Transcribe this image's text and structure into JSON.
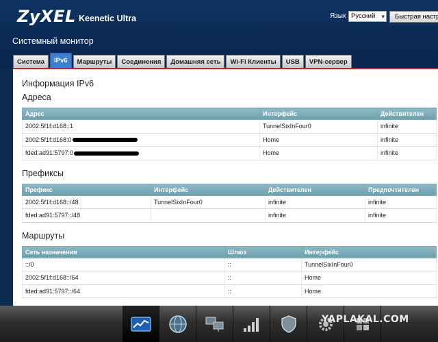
{
  "header": {
    "logo": "ZyXEL",
    "model": "Keenetic Ultra",
    "language_label": "Язык",
    "language_value": "Русский",
    "quick_setup_label": "Быстрая настр"
  },
  "page_title": "Системный монитор",
  "tabs": [
    {
      "label": "Система",
      "active": false
    },
    {
      "label": "IPv6",
      "active": true
    },
    {
      "label": "Маршруты",
      "active": false
    },
    {
      "label": "Соединения",
      "active": false
    },
    {
      "label": "Домашняя сеть",
      "active": false
    },
    {
      "label": "Wi-Fi Клиенты",
      "active": false
    },
    {
      "label": "USB",
      "active": false
    },
    {
      "label": "VPN-сервер",
      "active": false
    }
  ],
  "content": {
    "title": "Информация IPv6",
    "addresses": {
      "heading": "Адреса",
      "columns": [
        "Адрес",
        "Интерфейс",
        "Действителен"
      ],
      "rows": [
        [
          "2002:5f1f:d168::1",
          "TunnelSixInFour0",
          "infinite"
        ],
        [
          "2002:5f1f:d168:0",
          "Home",
          "infinite"
        ],
        [
          "fded:ad91:5797:0",
          "Home",
          "infinite"
        ]
      ]
    },
    "prefixes": {
      "heading": "Префиксы",
      "columns": [
        "Префикс",
        "Интерфейс",
        "Действителен",
        "Предпочтителен"
      ],
      "rows": [
        [
          "2002:5f1f:d168::/48",
          "TunnelSixInFour0",
          "infinite",
          "infinite"
        ],
        [
          "fded:ad91:5797::/48",
          "",
          "infinite",
          "infinite"
        ]
      ]
    },
    "routes": {
      "heading": "Маршруты",
      "columns": [
        "Сеть назначения",
        "Шлюз",
        "Интерфейс"
      ],
      "rows": [
        [
          "::/0",
          "::",
          "TunnelSixInFour0"
        ],
        [
          "2002:5f1f:d168::/64",
          "::",
          "Home"
        ],
        [
          "fded:ad91:5797::/64",
          "::",
          "Home"
        ]
      ]
    }
  },
  "footer": {
    "dock_icons": [
      "monitor-graph-icon",
      "globe-icon",
      "network-computers-icon",
      "wifi-signal-bars-icon",
      "shield-icon",
      "gear-icon",
      "puzzle-icon"
    ],
    "watermark": "YAPLAKAL.COM"
  }
}
